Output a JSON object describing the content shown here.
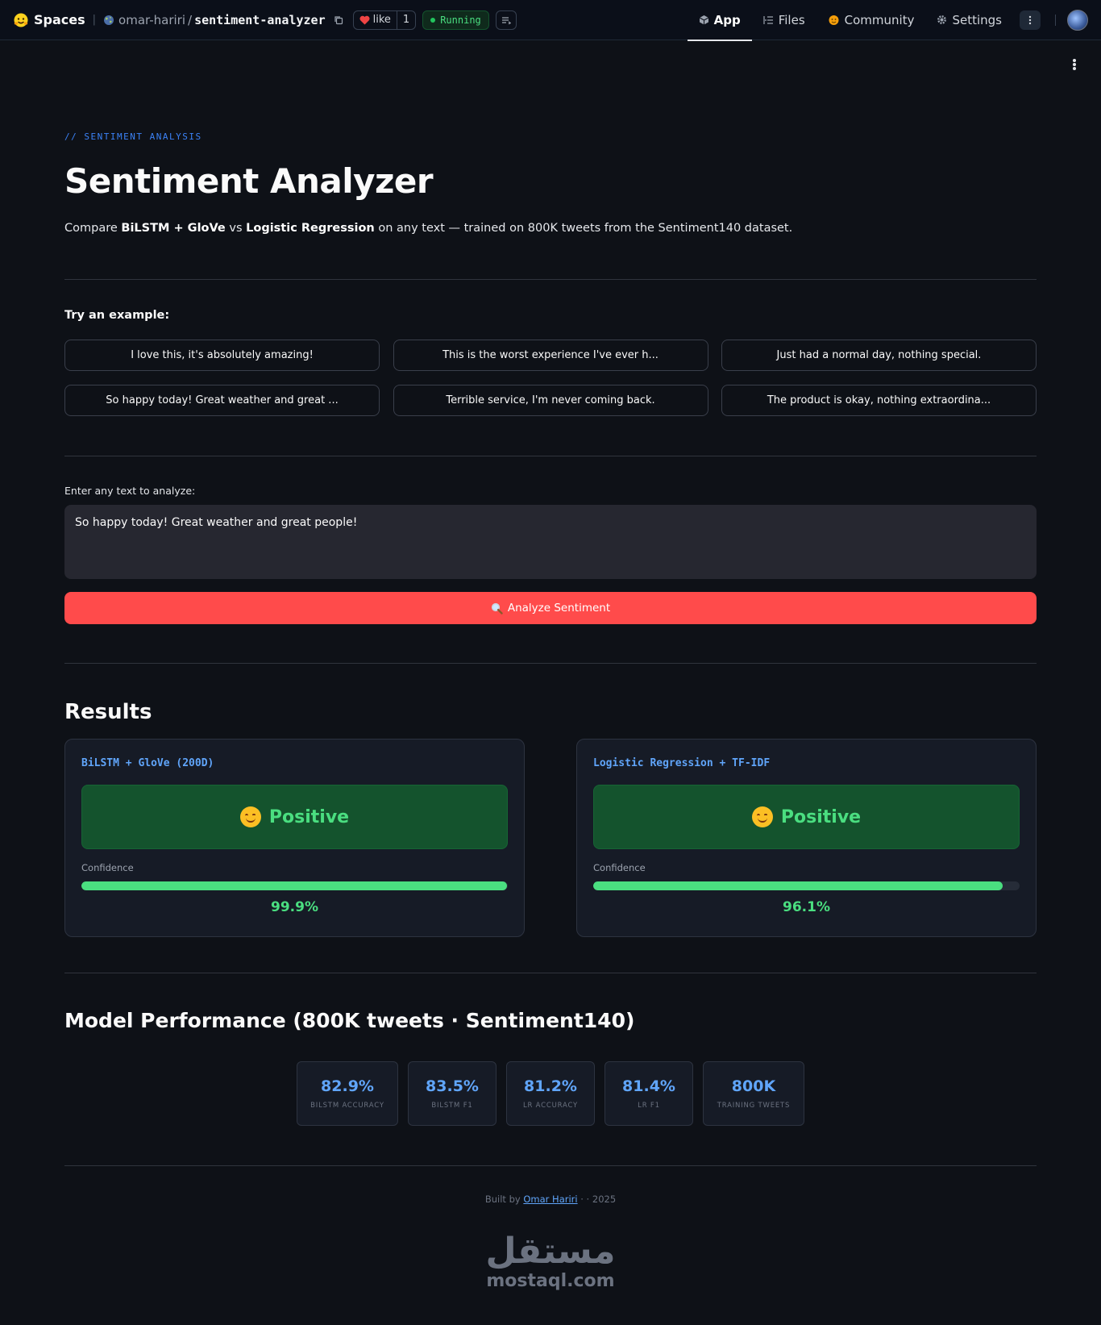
{
  "nav": {
    "brand": "Spaces",
    "owner": "omar-hariri",
    "slash": "/",
    "repo": "sentiment-analyzer",
    "like_label": "like",
    "like_count": "1",
    "status": "Running",
    "tabs": [
      {
        "label": "App",
        "icon": "cube-icon"
      },
      {
        "label": "Files",
        "icon": "files-icon"
      },
      {
        "label": "Community",
        "icon": "community-icon"
      },
      {
        "label": "Settings",
        "icon": "gear-icon"
      }
    ]
  },
  "header": {
    "eyebrow": "// SENTIMENT ANALYSIS",
    "title": "Sentiment Analyzer",
    "subtitle_parts": [
      "Compare ",
      "BiLSTM + GloVe",
      " vs ",
      "Logistic Regression",
      " on any text — trained on 800K tweets from the Sentiment140 dataset."
    ]
  },
  "examples": {
    "label": "Try an example:",
    "items": [
      "I love this, it's absolutely amazing!",
      "This is the worst experience I've ever h...",
      "Just had a normal day, nothing special.",
      "So happy today! Great weather and great ...",
      "Terrible service, I'm never coming back.",
      "The product is okay, nothing extraordina..."
    ]
  },
  "input": {
    "label": "Enter any text to analyze:",
    "value": "So happy today! Great weather and great people!",
    "button": "Analyze Sentiment",
    "button_icon": "magnifier-icon"
  },
  "results": {
    "title": "Results",
    "cards": [
      {
        "model": "BiLSTM + GloVe (200D)",
        "label": "Positive",
        "confidence_label": "Confidence",
        "confidence": 0.999,
        "confidence_text": "99.9%"
      },
      {
        "model": "Logistic Regression + TF-IDF",
        "label": "Positive",
        "confidence_label": "Confidence",
        "confidence": 0.961,
        "confidence_text": "96.1%"
      }
    ]
  },
  "performance": {
    "title": "Model Performance (800K tweets · Sentiment140)",
    "metrics": [
      {
        "value": "82.9%",
        "label": "BILSTM ACCURACY"
      },
      {
        "value": "83.5%",
        "label": "BILSTM F1"
      },
      {
        "value": "81.2%",
        "label": "LR ACCURACY"
      },
      {
        "value": "81.4%",
        "label": "LR F1"
      },
      {
        "value": "800K",
        "label": "TRAINING TWEETS"
      }
    ]
  },
  "footer": {
    "prefix": "Built by ",
    "author": "Omar Hariri",
    "suffix": " · · 2025"
  },
  "watermark": {
    "arabic": "مستقل",
    "latin": "mostaql.com"
  },
  "colors": {
    "accent": "#ff4b4b",
    "positive": "#4ade80",
    "link": "#60a5fa",
    "background": "#0e1117"
  }
}
